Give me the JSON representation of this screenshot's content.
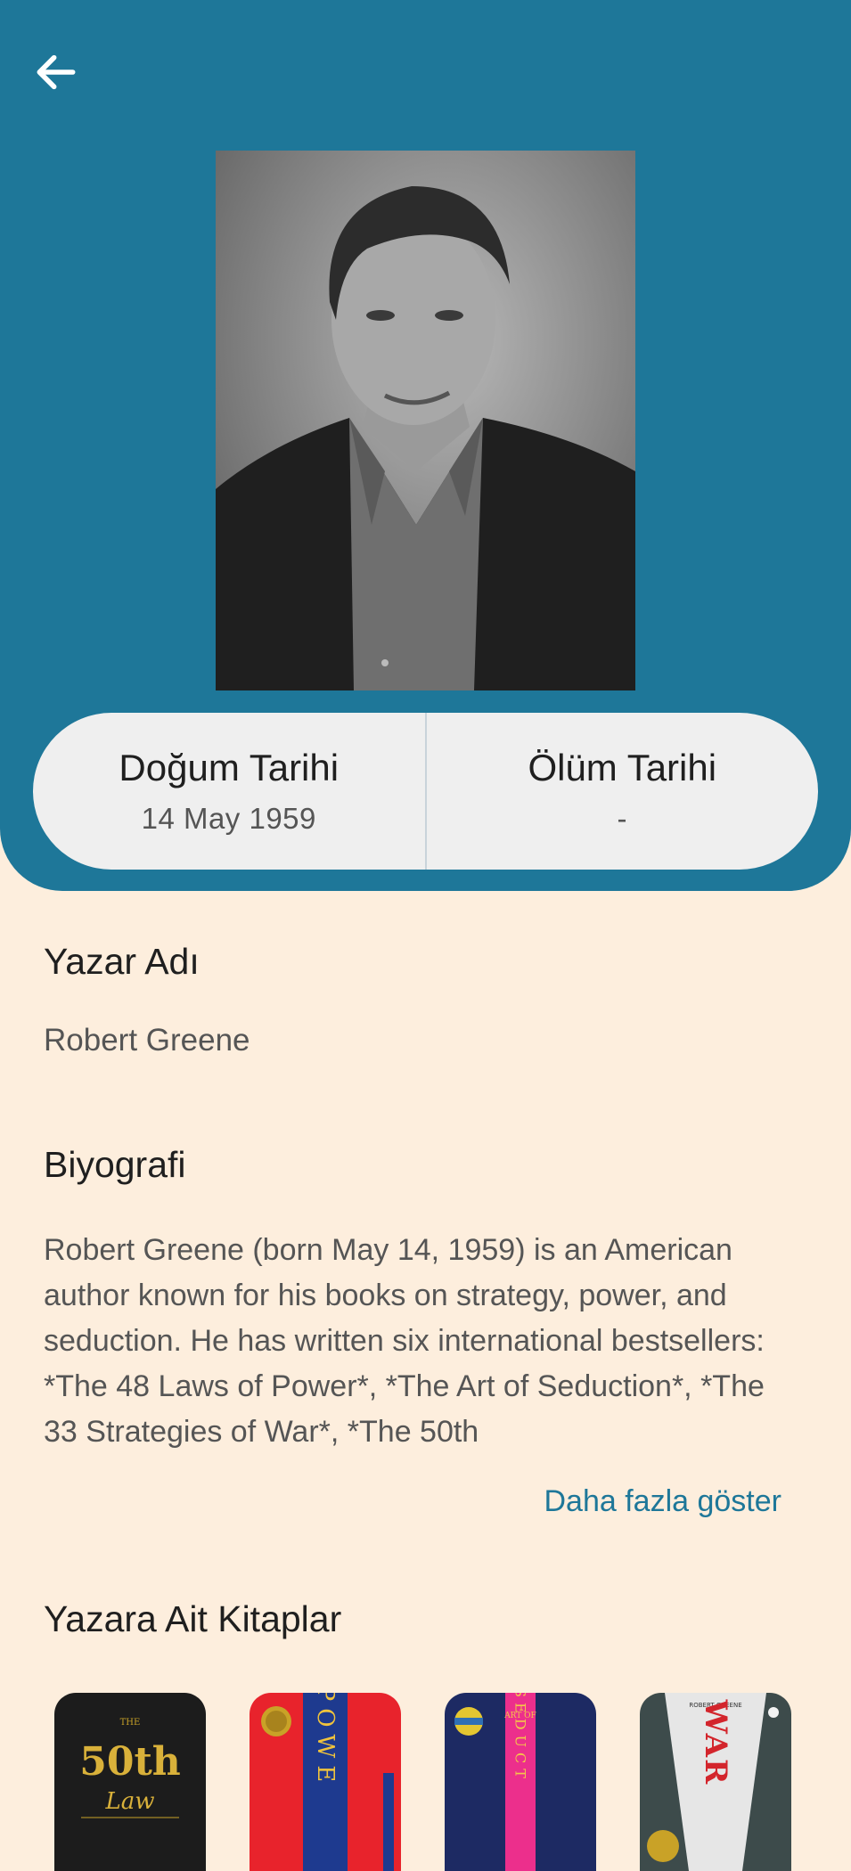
{
  "header": {
    "back_icon": "arrow-left-icon",
    "background_color": "#1e7799"
  },
  "author": {
    "birth_label": "Doğum Tarihi",
    "birth_value": "14 May 1959",
    "death_label": "Ölüm Tarihi",
    "death_value": "-"
  },
  "sections": {
    "name_title": "Yazar Adı",
    "name_value": "Robert Greene",
    "bio_title": "Biyografi",
    "bio_text": "Robert Greene (born May 14, 1959) is an American author known for his books on strategy, power, and seduction. He has written six international bestsellers: *The 48 Laws of Power*, *The Art of Seduction*, *The 33 Strategies of War*, *The 50th",
    "more_link": "Daha fazla göster",
    "books_title": "Yazara Ait Kitaplar"
  },
  "books": [
    {
      "cover_top": "THE",
      "cover_main": "50th",
      "cover_sub": "Law"
    },
    {
      "cover_main": "POWE"
    },
    {
      "cover_top": "ART OF",
      "cover_main": "SEDUCT"
    },
    {
      "cover_top": "ROBERT GREENE",
      "cover_main": "WAR"
    }
  ],
  "colors": {
    "accent": "#1e7799",
    "background": "#fdeedd",
    "card": "#efefef"
  }
}
